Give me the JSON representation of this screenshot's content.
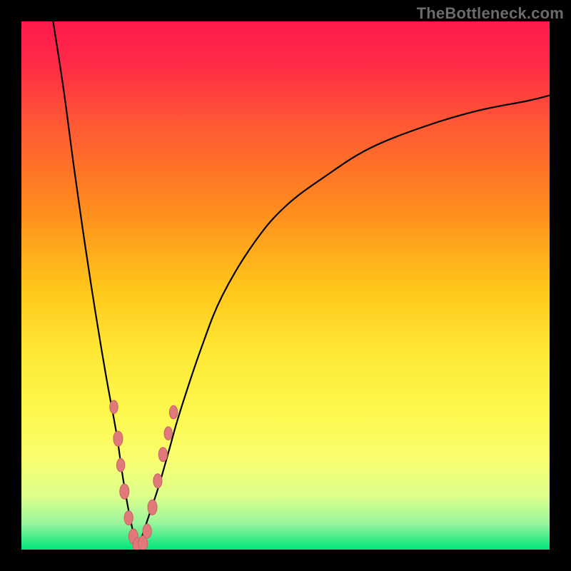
{
  "watermark": "TheBottleneck.com",
  "colors": {
    "frame": "#000000",
    "gradient_stops": [
      {
        "offset": 0.0,
        "color": "#ff1a4d"
      },
      {
        "offset": 0.08,
        "color": "#ff2a47"
      },
      {
        "offset": 0.2,
        "color": "#ff5a33"
      },
      {
        "offset": 0.35,
        "color": "#ff8a1f"
      },
      {
        "offset": 0.5,
        "color": "#ffc41a"
      },
      {
        "offset": 0.62,
        "color": "#ffe733"
      },
      {
        "offset": 0.74,
        "color": "#fdf84d"
      },
      {
        "offset": 0.83,
        "color": "#faff70"
      },
      {
        "offset": 0.9,
        "color": "#dcff8c"
      },
      {
        "offset": 0.95,
        "color": "#99f59c"
      },
      {
        "offset": 1.0,
        "color": "#00e57a"
      }
    ],
    "curve": "#000000",
    "marker_fill": "#e07a7a",
    "marker_stroke": "#c96363"
  },
  "chart_data": {
    "type": "line",
    "title": "",
    "xlabel": "",
    "ylabel": "",
    "xlim": [
      0,
      100
    ],
    "ylim": [
      0,
      100
    ],
    "note": "No numeric axis ticks or labels visible; x/y values estimated from pixel positions against gradient band and frame.",
    "vertex_x": 22,
    "series": [
      {
        "name": "left-branch",
        "x": [
          6,
          8,
          10,
          12,
          14,
          16,
          18,
          19,
          20,
          21,
          22
        ],
        "y": [
          100,
          87,
          72,
          58,
          45,
          33,
          22,
          15,
          9,
          4,
          0
        ]
      },
      {
        "name": "right-branch",
        "x": [
          22,
          24,
          26,
          28,
          30,
          34,
          38,
          44,
          50,
          58,
          66,
          76,
          86,
          96,
          100
        ],
        "y": [
          0,
          6,
          12,
          19,
          26,
          38,
          48,
          58,
          65,
          71,
          76,
          80,
          83,
          85,
          86
        ]
      }
    ],
    "markers": {
      "name": "highlighted-points",
      "points": [
        {
          "x": 17.5,
          "y": 27,
          "r": 1.4
        },
        {
          "x": 18.3,
          "y": 21,
          "r": 1.6
        },
        {
          "x": 18.8,
          "y": 16,
          "r": 1.4
        },
        {
          "x": 19.5,
          "y": 11,
          "r": 1.6
        },
        {
          "x": 20.3,
          "y": 6,
          "r": 1.5
        },
        {
          "x": 21.2,
          "y": 2.5,
          "r": 1.6
        },
        {
          "x": 22.0,
          "y": 0.8,
          "r": 1.6
        },
        {
          "x": 23.0,
          "y": 1.2,
          "r": 1.6
        },
        {
          "x": 23.8,
          "y": 3.5,
          "r": 1.5
        },
        {
          "x": 24.8,
          "y": 8,
          "r": 1.6
        },
        {
          "x": 25.8,
          "y": 13,
          "r": 1.5
        },
        {
          "x": 26.8,
          "y": 18,
          "r": 1.5
        },
        {
          "x": 27.8,
          "y": 22,
          "r": 1.4
        },
        {
          "x": 28.8,
          "y": 26,
          "r": 1.4
        }
      ]
    }
  }
}
